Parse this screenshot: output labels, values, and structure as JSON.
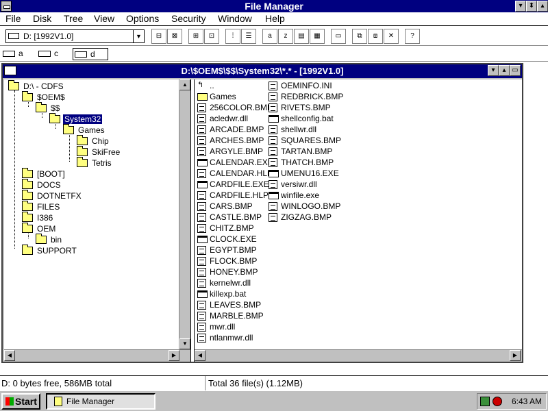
{
  "app": {
    "title": "File Manager",
    "system_menu_icon": "window-menu-icon",
    "minimize_symbol": "▾",
    "maximize_symbol": "▴"
  },
  "menu": [
    "File",
    "Disk",
    "Tree",
    "View",
    "Options",
    "Security",
    "Window",
    "Help"
  ],
  "toolbar": {
    "drive_select_value": "D: [1992V1.0]",
    "buttons": [
      "connect-net-drive-icon",
      "disconnect-net-drive-icon",
      "share-as-icon",
      "stop-sharing-icon",
      "view-name-icon",
      "view-details-icon",
      "sort-by-name-icon",
      "sort-by-type-icon",
      "sort-by-size-icon",
      "sort-by-date-icon",
      "new-window-icon",
      "copy-icon",
      "move-icon",
      "delete-icon",
      "help-icon"
    ]
  },
  "drives": [
    {
      "letter": "a",
      "selected": false
    },
    {
      "letter": "c",
      "selected": false
    },
    {
      "letter": "d",
      "selected": true
    }
  ],
  "document_window": {
    "title": "D:\\$OEM$\\$$\\System32\\*.* - [1992V1.0]"
  },
  "tree": [
    {
      "label": "D:\\ - CDFS",
      "level": 0,
      "selected": false
    },
    {
      "label": "$OEM$",
      "level": 1,
      "selected": false
    },
    {
      "label": "$$",
      "level": 2,
      "selected": false
    },
    {
      "label": "System32",
      "level": 3,
      "selected": true
    },
    {
      "label": "Games",
      "level": 4,
      "selected": false
    },
    {
      "label": "Chip",
      "level": 5,
      "selected": false
    },
    {
      "label": "SkiFree",
      "level": 5,
      "selected": false
    },
    {
      "label": "Tetris",
      "level": 5,
      "selected": false
    },
    {
      "label": "[BOOT]",
      "level": 1,
      "selected": false
    },
    {
      "label": "DOCS",
      "level": 1,
      "selected": false
    },
    {
      "label": "DOTNETFX",
      "level": 1,
      "selected": false
    },
    {
      "label": "FILES",
      "level": 1,
      "selected": false
    },
    {
      "label": "I386",
      "level": 1,
      "selected": false
    },
    {
      "label": "OEM",
      "level": 1,
      "selected": false
    },
    {
      "label": "bin",
      "level": 2,
      "selected": false
    },
    {
      "label": "SUPPORT",
      "level": 1,
      "selected": false
    }
  ],
  "files_col1": [
    {
      "name": "..",
      "type": "up"
    },
    {
      "name": "Games",
      "type": "folder"
    },
    {
      "name": "256COLOR.BMP",
      "type": "doc"
    },
    {
      "name": "acledwr.dll",
      "type": "doc"
    },
    {
      "name": "ARCADE.BMP",
      "type": "doc"
    },
    {
      "name": "ARCHES.BMP",
      "type": "doc"
    },
    {
      "name": "ARGYLE.BMP",
      "type": "doc"
    },
    {
      "name": "CALENDAR.EXE",
      "type": "exe"
    },
    {
      "name": "CALENDAR.HLP",
      "type": "doc"
    },
    {
      "name": "CARDFILE.EXE",
      "type": "exe"
    },
    {
      "name": "CARDFILE.HLP",
      "type": "doc"
    },
    {
      "name": "CARS.BMP",
      "type": "doc"
    },
    {
      "name": "CASTLE.BMP",
      "type": "doc"
    },
    {
      "name": "CHITZ.BMP",
      "type": "doc"
    },
    {
      "name": "CLOCK.EXE",
      "type": "exe"
    },
    {
      "name": "EGYPT.BMP",
      "type": "doc"
    },
    {
      "name": "FLOCK.BMP",
      "type": "doc"
    },
    {
      "name": "HONEY.BMP",
      "type": "doc"
    },
    {
      "name": "kernelwr.dll",
      "type": "doc"
    },
    {
      "name": "killexp.bat",
      "type": "exe"
    },
    {
      "name": "LEAVES.BMP",
      "type": "doc"
    },
    {
      "name": "MARBLE.BMP",
      "type": "doc"
    },
    {
      "name": "mwr.dll",
      "type": "doc"
    },
    {
      "name": "ntlanmwr.dll",
      "type": "doc"
    }
  ],
  "files_col2": [
    {
      "name": "OEMINFO.INI",
      "type": "doc"
    },
    {
      "name": "REDBRICK.BMP",
      "type": "doc"
    },
    {
      "name": "RIVETS.BMP",
      "type": "doc"
    },
    {
      "name": "shellconfig.bat",
      "type": "exe"
    },
    {
      "name": "shellwr.dll",
      "type": "doc"
    },
    {
      "name": "SQUARES.BMP",
      "type": "doc"
    },
    {
      "name": "TARTAN.BMP",
      "type": "doc"
    },
    {
      "name": "THATCH.BMP",
      "type": "doc"
    },
    {
      "name": "UMENU16.EXE",
      "type": "exe"
    },
    {
      "name": "versiwr.dll",
      "type": "doc"
    },
    {
      "name": "winfile.exe",
      "type": "exe"
    },
    {
      "name": "WINLOGO.BMP",
      "type": "doc"
    },
    {
      "name": "ZIGZAG.BMP",
      "type": "doc"
    }
  ],
  "status": {
    "left": "D: 0 bytes free,  586MB total",
    "right": "Total 36 file(s) (1.12MB)"
  },
  "taskbar": {
    "start_label": "Start",
    "task_label": "File Manager",
    "clock": "6:43 AM"
  },
  "colors": {
    "active_title": "#000080",
    "face": "#c0c0c0",
    "folder": "#ffff80"
  }
}
